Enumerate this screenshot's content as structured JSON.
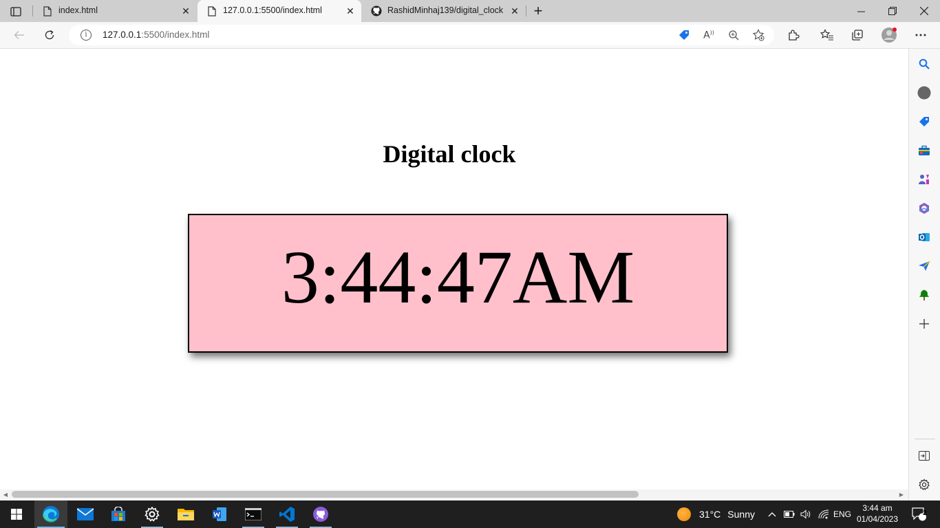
{
  "tabs": [
    {
      "title": "index.html",
      "active": false
    },
    {
      "title": "127.0.0.1:5500/index.html",
      "active": true
    },
    {
      "title": "RashidMinhaj139/digital_clock",
      "active": false
    }
  ],
  "address": {
    "host": "127.0.0.1",
    "path": ":5500/index.html"
  },
  "page": {
    "heading": "Digital clock",
    "clock_time": "3:44:47AM",
    "clock_bg": "#ffc0cb"
  },
  "sidebar": {
    "items": [
      "search-icon",
      "circle-icon",
      "tag-icon",
      "toolbox-icon",
      "games-icon",
      "office-icon",
      "outlook-icon",
      "send-icon",
      "tree-icon",
      "add-icon"
    ],
    "bottom": [
      "split-screen-icon",
      "settings-icon"
    ]
  },
  "taskbar": {
    "apps": [
      "start-icon",
      "edge-icon",
      "mail-icon",
      "store-icon",
      "settings-icon",
      "file-explorer-icon",
      "word-icon",
      "terminal-icon",
      "vscode-icon",
      "github-desktop-icon"
    ],
    "weather_temp": "31°C",
    "weather_text": "Sunny",
    "language": "ENG",
    "time": "3:44 am",
    "date": "01/04/2023",
    "notification_count": "2"
  }
}
